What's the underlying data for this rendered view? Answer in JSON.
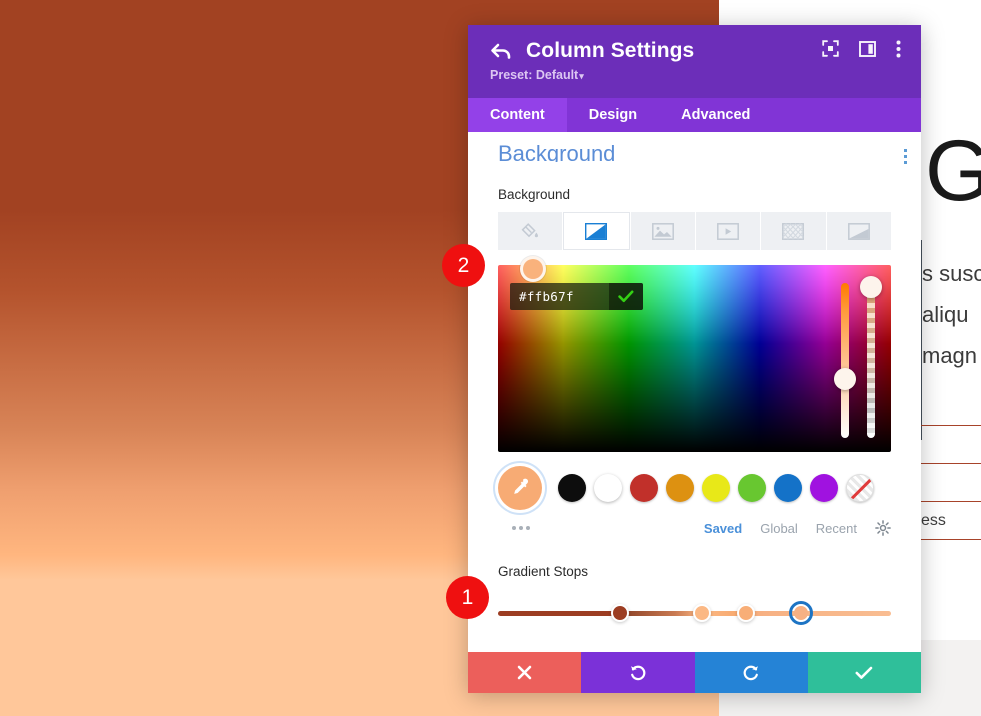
{
  "backdrop": {
    "gradient_from": "#a24222",
    "gradient_to": "#ffc79a",
    "peek_letter": "G",
    "peek_lines": [
      "s susc",
      "aliqu",
      "magn"
    ],
    "peek_rows": [
      "",
      "",
      "ess",
      ""
    ]
  },
  "modal": {
    "title": "Column Settings",
    "preset_label": "Preset: Default",
    "preset_caret": "▾",
    "header_icons": [
      {
        "name": "focus-target-icon"
      },
      {
        "name": "panel-layout-icon"
      },
      {
        "name": "overflow-menu-icon"
      }
    ],
    "tabs": [
      {
        "label": "Content",
        "active": true
      },
      {
        "label": "Design",
        "active": false
      },
      {
        "label": "Advanced",
        "active": false
      }
    ],
    "section": {
      "title": "Background",
      "field_label": "Background",
      "bg_types": [
        {
          "name": "background-color-icon",
          "active": false
        },
        {
          "name": "background-gradient-icon",
          "active": true
        },
        {
          "name": "background-image-icon",
          "active": false
        },
        {
          "name": "background-video-icon",
          "active": false
        },
        {
          "name": "background-pattern-icon",
          "active": false
        },
        {
          "name": "background-mask-icon",
          "active": false
        }
      ]
    },
    "color_picker": {
      "hex_value": "#ffb67f",
      "hex_placeholder": "#ffffff",
      "confirm_icon": "checkmark-icon",
      "hue_slider_pct": 62,
      "alpha_slider_pct": 6,
      "swatches": [
        {
          "name": "swatch-black",
          "color": "#0d0d0d"
        },
        {
          "name": "swatch-white",
          "color": "#ffffff"
        },
        {
          "name": "swatch-red",
          "color": "#c1302a"
        },
        {
          "name": "swatch-amber",
          "color": "#dd9111"
        },
        {
          "name": "swatch-yellow",
          "color": "#e8e818"
        },
        {
          "name": "swatch-green",
          "color": "#68c730"
        },
        {
          "name": "swatch-blue",
          "color": "#1472c8"
        },
        {
          "name": "swatch-purple",
          "color": "#a012e0"
        },
        {
          "name": "swatch-transparent",
          "color": "transparent"
        }
      ],
      "eyedropper_color": "#f7ab74",
      "more_label": "",
      "tabs": [
        {
          "label": "Saved",
          "active": true
        },
        {
          "label": "Global",
          "active": false
        },
        {
          "label": "Recent",
          "active": false
        }
      ],
      "settings_icon": "gear-icon"
    },
    "gradient_stops": {
      "label": "Gradient Stops",
      "stops": [
        {
          "pct": 31,
          "color": "#9c3d22",
          "selected": false
        },
        {
          "pct": 52,
          "color": "#fbb884",
          "selected": false
        },
        {
          "pct": 63,
          "color": "#f8ae77",
          "selected": false
        },
        {
          "pct": 77,
          "color": "#f7b184",
          "selected": true
        }
      ]
    },
    "footer": [
      {
        "name": "cancel-button",
        "icon": "close-icon"
      },
      {
        "name": "undo-button",
        "icon": "undo-icon"
      },
      {
        "name": "redo-button",
        "icon": "redo-icon"
      },
      {
        "name": "save-button",
        "icon": "checkmark-icon"
      }
    ]
  },
  "step_badges": [
    {
      "label": "1"
    },
    {
      "label": "2"
    }
  ]
}
